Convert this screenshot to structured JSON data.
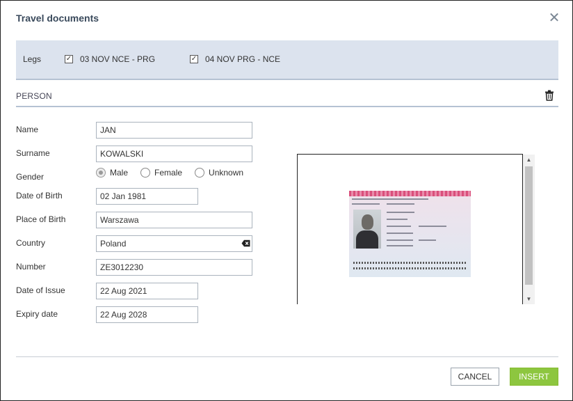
{
  "dialog": {
    "title": "Travel documents",
    "close_icon": "close-icon"
  },
  "legs": {
    "label": "Legs",
    "items": [
      {
        "label": "03 NOV NCE - PRG",
        "checked": true
      },
      {
        "label": "04 NOV PRG - NCE",
        "checked": true
      }
    ]
  },
  "person": {
    "section_title": "PERSON",
    "delete_icon": "trash-icon",
    "fields": {
      "name": {
        "label": "Name",
        "value": "JAN"
      },
      "surname": {
        "label": "Surname",
        "value": "KOWALSKI"
      },
      "gender": {
        "label": "Gender",
        "options": [
          "Male",
          "Female",
          "Unknown"
        ],
        "selected": "Male"
      },
      "date_of_birth": {
        "label": "Date of Birth",
        "value": "02 Jan 1981"
      },
      "place_of_birth": {
        "label": "Place of Birth",
        "value": "Warszawa"
      },
      "country": {
        "label": "Country",
        "value": "Poland",
        "clear_icon": "backspace-icon"
      },
      "number": {
        "label": "Number",
        "value": "ZE3012230"
      },
      "date_of_issue": {
        "label": "Date of Issue",
        "value": "22 Aug 2021"
      },
      "expiry_date": {
        "label": "Expiry date",
        "value": "22 Aug 2028"
      }
    }
  },
  "preview": {
    "image": "passport-scan-image",
    "scroll_up_icon": "scroll-up-arrow-icon",
    "scroll_down_icon": "scroll-down-arrow-icon"
  },
  "footer": {
    "cancel_label": "CANCEL",
    "insert_label": "INSERT"
  },
  "colors": {
    "legs_background": "#dce3ee",
    "divider": "#b5c2d3",
    "insert_button": "#8dc63f",
    "title_text": "#3a4a5c"
  }
}
